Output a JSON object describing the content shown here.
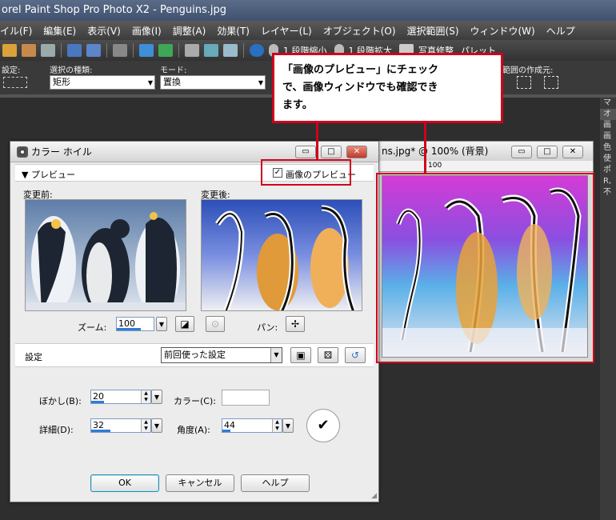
{
  "app": {
    "title": "orel Paint Shop Pro Photo X2 - Penguins.jpg",
    "menu": [
      "イル(F)",
      "編集(E)",
      "表示(V)",
      "画像(I)",
      "調整(A)",
      "効果(T)",
      "レイヤー(L)",
      "オブジェクト(O)",
      "選択範囲(S)",
      "ウィンドウ(W)",
      "ヘルプ"
    ],
    "toolbar": {
      "zoom_out_label": "1 段階縮小",
      "zoom_in_label": "1 段階拡大",
      "photo_fix_label": "写真修整",
      "palette_label": "パレット"
    },
    "options": {
      "settings_label": "設定:",
      "selection_type_label": "選択の種類:",
      "selection_type_value": "矩形",
      "mode_label": "モード:",
      "mode_value": "置換",
      "create_label": "範囲の作成元:"
    },
    "right_palette": [
      "マ",
      "オ",
      "画",
      "画",
      "色",
      "使",
      "ポ",
      "R,",
      "不"
    ]
  },
  "image_window": {
    "title": "ns.jpg* @ 100% (背景)",
    "ruler_mark": "100"
  },
  "dialog": {
    "title": "カラー ホイル",
    "preview_toggle": "▼ プレビュー",
    "image_preview_label": "画像のプレビュー",
    "before_label": "変更前:",
    "after_label": "変更後:",
    "zoom_label": "ズーム:",
    "zoom_value": "100",
    "pan_label": "パン:",
    "settings_label": "設定",
    "settings_value": "前回使った設定",
    "blur_label": "ぼかし(B):",
    "blur_value": "20",
    "color_label": "カラー(C):",
    "detail_label": "詳細(D):",
    "detail_value": "32",
    "angle_label": "角度(A):",
    "angle_value": "44",
    "ok_label": "OK",
    "cancel_label": "キャンセル",
    "help_label": "ヘルプ"
  },
  "callout": {
    "line1": "「画像のプレビュー」にチェック",
    "line2": "で、画像ウィンドウでも確認でき",
    "line3": "ます。"
  },
  "colors": {
    "accent_red": "#d0021b",
    "slider_blue": "#2f7bd6"
  }
}
